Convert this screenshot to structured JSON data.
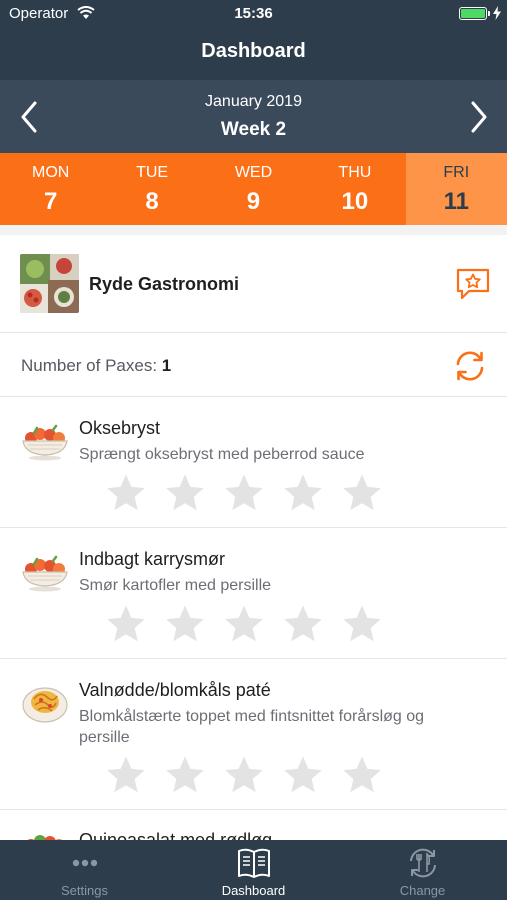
{
  "status_bar": {
    "carrier": "Operator",
    "time": "15:36",
    "battery_level": 1.0,
    "battery_color": "#4cd964"
  },
  "nav": {
    "title": "Dashboard"
  },
  "week_selector": {
    "month": "January 2019",
    "week": "Week 2",
    "prev_icon": "chevron-left-icon",
    "next_icon": "chevron-right-icon"
  },
  "days": [
    {
      "name": "MON",
      "number": "7",
      "selected": false
    },
    {
      "name": "TUE",
      "number": "8",
      "selected": false
    },
    {
      "name": "WED",
      "number": "9",
      "selected": false
    },
    {
      "name": "THU",
      "number": "10",
      "selected": false
    },
    {
      "name": "FRI",
      "number": "11",
      "selected": true
    }
  ],
  "restaurant": {
    "name": "Ryde Gastronomi",
    "rate_icon": "star-speech-bubble-icon"
  },
  "paxes": {
    "label": "Number of Paxes:",
    "count": "1",
    "refresh_icon": "refresh-icon"
  },
  "dishes": [
    {
      "name": "Oksebryst",
      "description": "Sprængt oksebryst med peberrod sauce",
      "rating": 0,
      "max_rating": 5,
      "icon": "salad-bowl-icon"
    },
    {
      "name": "Indbagt karrysmør",
      "description": "Smør kartofler med persille",
      "rating": 0,
      "max_rating": 5,
      "icon": "salad-bowl-icon"
    },
    {
      "name": "Valnødde/blomkåls paté",
      "description": "Blomkålstærte toppet med fintsnittet forårsløg og persille",
      "rating": 0,
      "max_rating": 5,
      "icon": "pasta-plate-icon"
    }
  ],
  "partial_dish": {
    "name": "Quinoasalat med rødløg"
  },
  "tabs": [
    {
      "label": "Settings",
      "icon": "more-dots-icon",
      "active": false
    },
    {
      "label": "Dashboard",
      "icon": "book-icon",
      "active": true
    },
    {
      "label": "Change",
      "icon": "utensils-swap-icon",
      "active": false
    }
  ],
  "colors": {
    "navy": "#2e3d4c",
    "week_bar": "#3a4a5b",
    "accent_orange": "#fb6f17",
    "selected_day": "#fd9448",
    "star_empty": "#e3e3e3"
  }
}
